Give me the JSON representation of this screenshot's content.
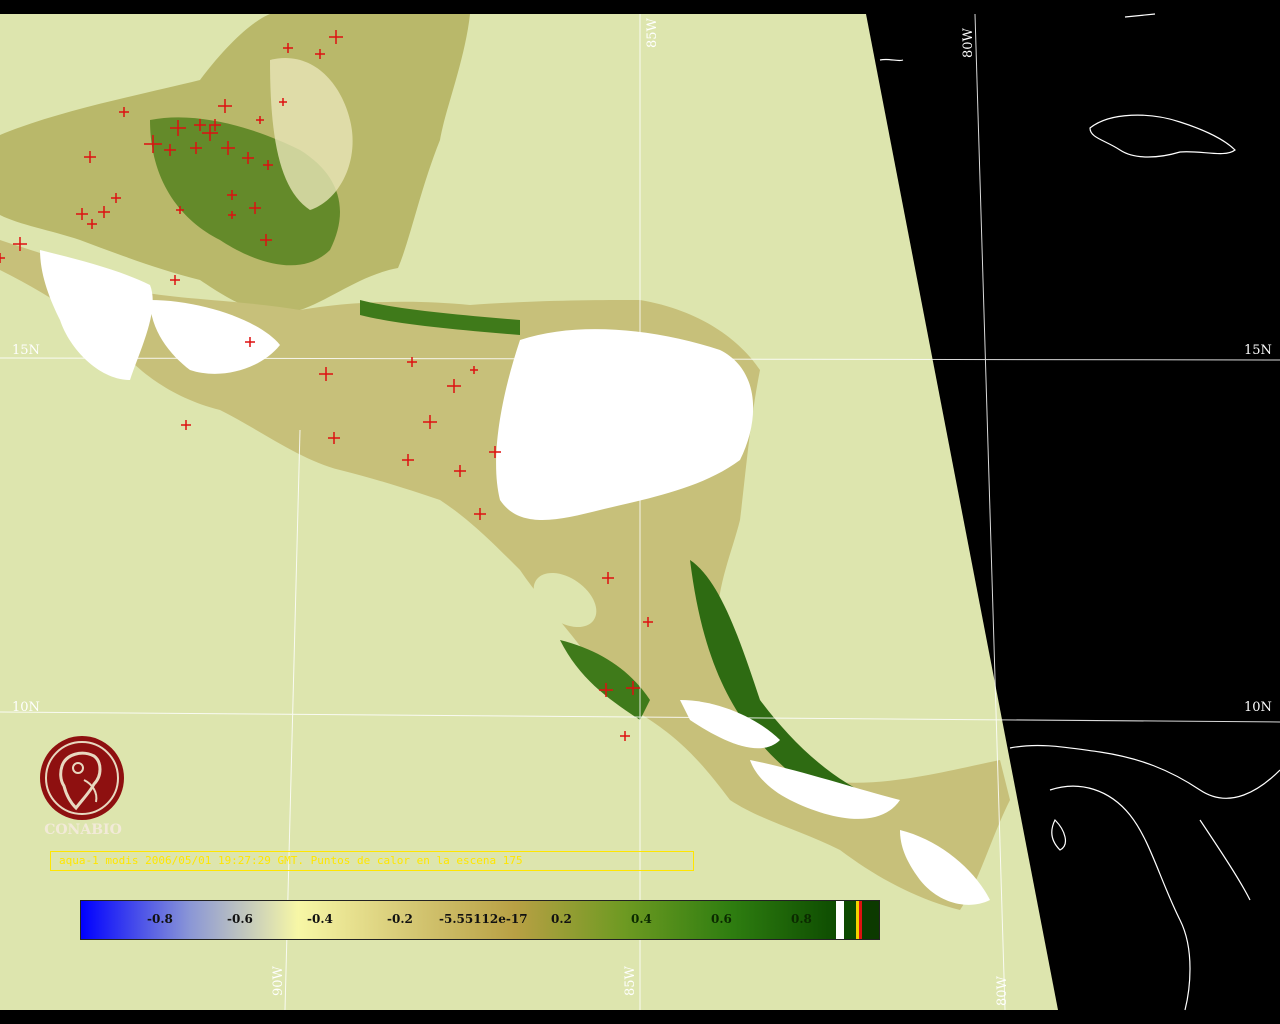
{
  "map": {
    "graticule_labels": {
      "lat_15_left": "15N",
      "lat_15_right": "15N",
      "lat_10_left": "10N",
      "lat_10_right": "10N",
      "lon_85_top": "85W",
      "lon_80_top": "80W",
      "lon_90_bottom": "90W",
      "lon_85_bottom": "85W",
      "lon_80_bottom": "80W"
    },
    "colors": {
      "background_land_data": "#dde5ae",
      "no_data": "#000000",
      "graticule": "#ffffff",
      "hotspot": "#dd1111",
      "cloud": "#ffffff"
    }
  },
  "logo": {
    "icon": "conabio-logo-icon",
    "text": "CONABIO"
  },
  "caption": "aqua-1 modis 2006/05/01 19:27:29 GMT. Puntos de calor en la escena 175",
  "colorbar": {
    "labels": [
      "-0.8",
      "-0.6",
      "-0.4",
      "-0.2",
      "-5.55112e-17",
      "0.2",
      "0.4",
      "0.6",
      "0.8"
    ],
    "colors": [
      "#0000ff",
      "#8a96d6",
      "#f7f7a6",
      "#d6c976",
      "#b8a044",
      "#6e9a22",
      "#2e7d10",
      "#0c4a00"
    ]
  }
}
